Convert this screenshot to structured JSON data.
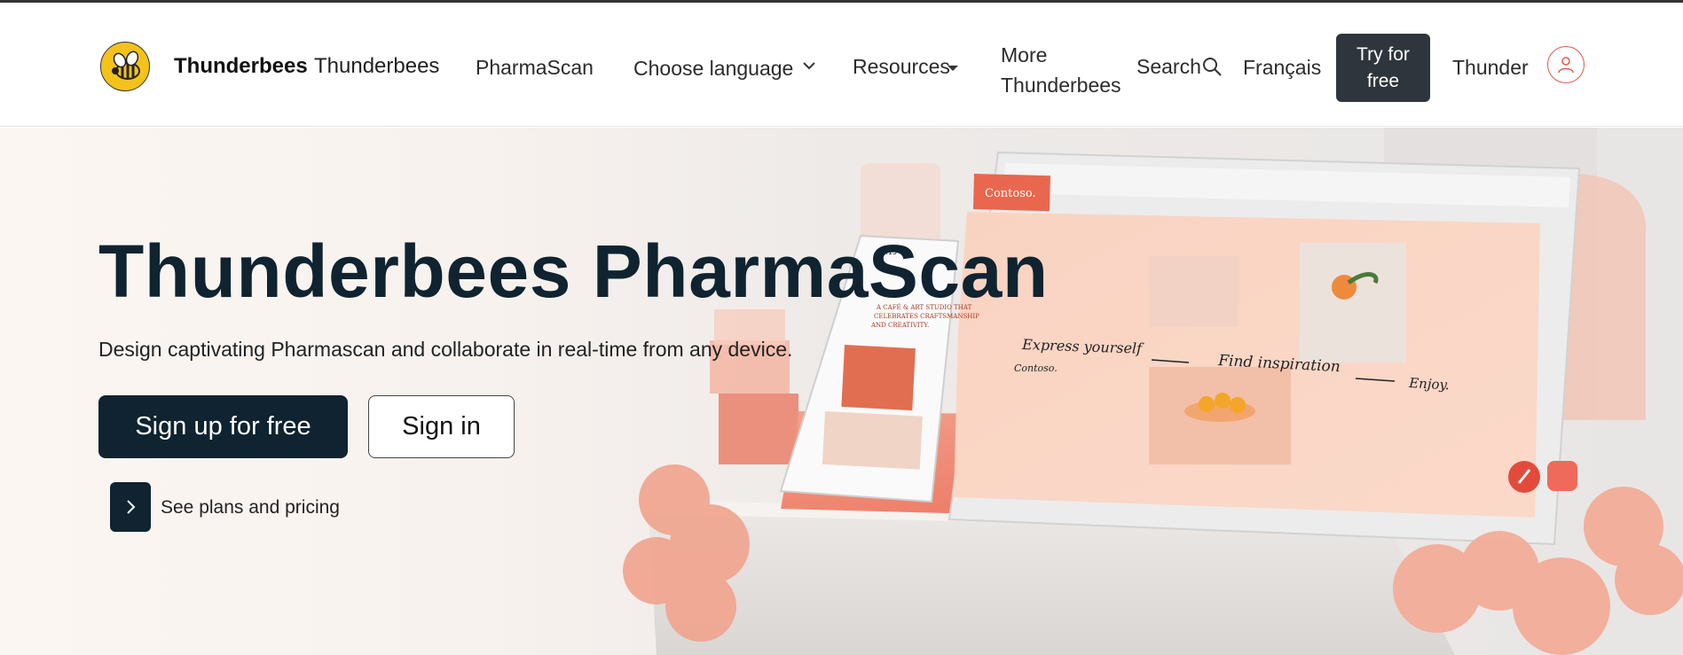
{
  "header": {
    "brand_bold": "Thunderbees",
    "brand_name": "Thunderbees",
    "nav": {
      "pharmascan": "PharmaScan",
      "choose_language": "Choose language",
      "resources": "Resources",
      "more": "More Thunderbees",
      "search": "Search",
      "language_fr": "Français",
      "try_free": "Try for free",
      "thunder": "Thunder"
    }
  },
  "hero": {
    "title": "Thunderbees PharmaScan",
    "subtitle": "Design captivating Pharmascan and collaborate in real-time from any device.",
    "signup_label": "Sign up for free",
    "signin_label": "Sign in",
    "plans_label": "See plans and pricing"
  },
  "device_art": {
    "tablet_brand": "Contoso.",
    "slide_text_1": "Express yourself",
    "slide_text_2": "Find inspiration",
    "slide_text_3": "Enjoy.",
    "slide_brand": "Contoso.",
    "phone_time": "12:15",
    "phone_heading": "A CAFÉ & ART STUDIO THAT CELEBRATES CRAFTSMANSHIP AND CREATIVITY."
  },
  "colors": {
    "primary_dark": "#0f2330",
    "try_button": "#2f353c",
    "accent_coral": "#e4574d",
    "logo_yellow": "#f4c21b"
  }
}
